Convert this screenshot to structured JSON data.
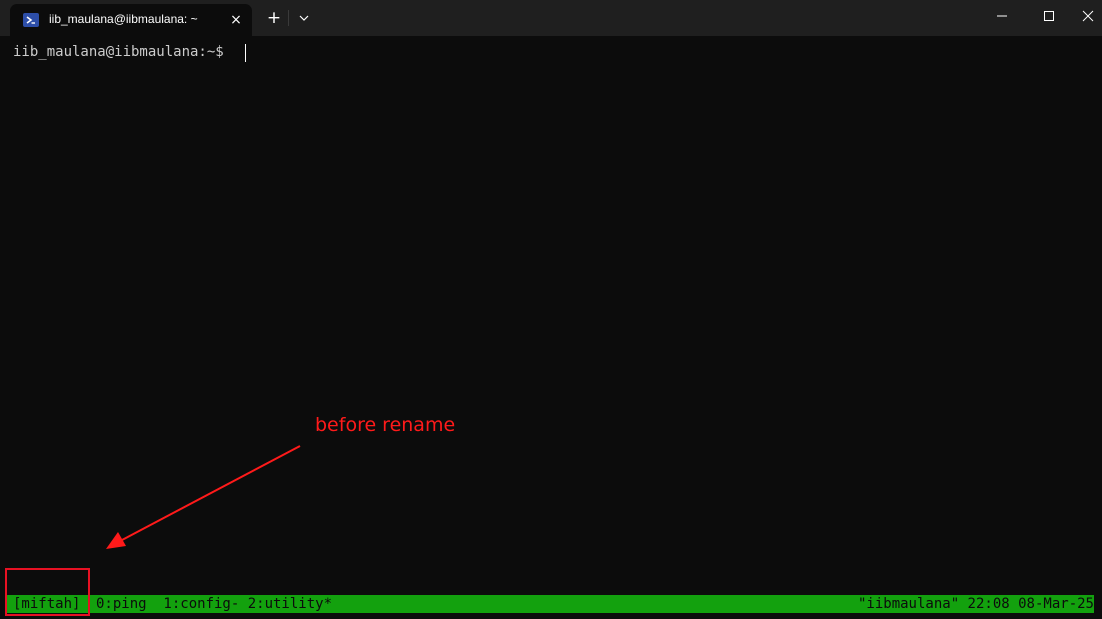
{
  "tab": {
    "title": "iib_maulana@iibmaulana: ~",
    "icon": "powershell-icon"
  },
  "titlebar": {
    "new_tab": "+",
    "close_tab": "×"
  },
  "terminal": {
    "prompt": "iib_maulana@iibmaulana:~$"
  },
  "annotation": {
    "text": "before rename",
    "color": "#ff1a1a"
  },
  "statusbar": {
    "session": "[miftah]",
    "windows": "0:ping  1:config- 2:utility*",
    "right": "\"iibmaulana\" 22:08 08-Mar-25",
    "color": "#13a10e"
  }
}
